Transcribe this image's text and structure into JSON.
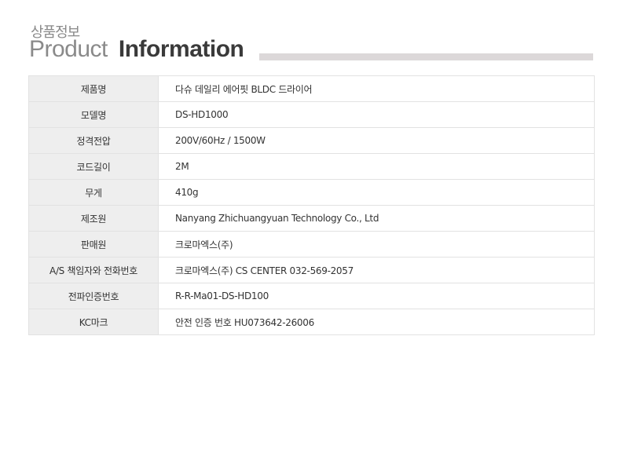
{
  "header": {
    "subtitle": "상품정보",
    "title_light": "Product",
    "title_bold": "Information"
  },
  "spec_rows": [
    {
      "label": "제품명",
      "value": "다슈 데일리 에어핏 BLDC 드라이어"
    },
    {
      "label": "모델명",
      "value": "DS-HD1000"
    },
    {
      "label": "정격전압",
      "value": "200V/60Hz / 1500W"
    },
    {
      "label": "코드길이",
      "value": "2M"
    },
    {
      "label": "무게",
      "value": "410g"
    },
    {
      "label": "제조원",
      "value": "Nanyang Zhichuangyuan Technology Co., Ltd"
    },
    {
      "label": "판매원",
      "value": "크로마엑스(주)"
    },
    {
      "label": "A/S 책임자와 전화번호",
      "value": "크로마엑스(주) CS CENTER 032-569-2057"
    },
    {
      "label": "전파인증번호",
      "value": "R-R-Ma01-DS-HD100"
    },
    {
      "label": "KC마크",
      "value": "안전 인증 번호 HU073642-26006"
    }
  ]
}
